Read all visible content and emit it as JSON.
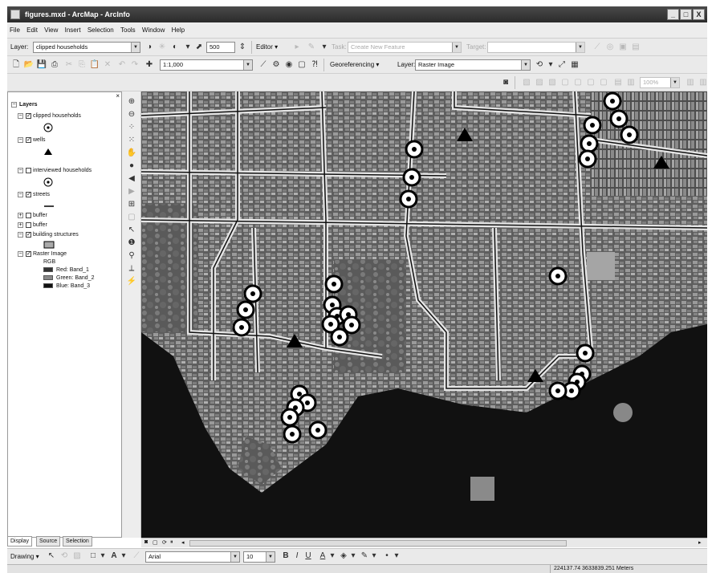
{
  "window": {
    "title": "figures.mxd - ArcMap - ArcInfo",
    "buttons": [
      "_",
      "□",
      "X"
    ]
  },
  "menu": [
    "File",
    "Edit",
    "View",
    "Insert",
    "Selection",
    "Tools",
    "Window",
    "Help"
  ],
  "toolbar1": {
    "layer_label": "Layer:",
    "layer_value": "clipped households",
    "scale_value": "500",
    "editor_label": "Editor ▾",
    "task_label": "Task:",
    "task_value": "Create New Feature",
    "target_label": "Target:",
    "target_value": ""
  },
  "toolbar2": {
    "scale_value": "1:1,000",
    "georef_label": "Georeferencing ▾",
    "layer_label": "Layer:",
    "layer_value": "Raster Image"
  },
  "toolbar3": {
    "zoom_value": "100%"
  },
  "toc": {
    "root": "Layers",
    "layers": [
      {
        "name": "clipped households",
        "checked": true,
        "expanded": true
      },
      {
        "name": "wells",
        "checked": true,
        "expanded": true
      },
      {
        "name": "interviewed households",
        "checked": false,
        "expanded": true
      },
      {
        "name": "streets",
        "checked": true,
        "expanded": true
      },
      {
        "name": "buffer",
        "checked": false,
        "expanded": false
      },
      {
        "name": "buffer",
        "checked": false,
        "expanded": false
      },
      {
        "name": "building structures",
        "checked": true,
        "expanded": true
      },
      {
        "name": "Raster Image",
        "checked": true,
        "expanded": true
      }
    ],
    "rgb_label": "RGB",
    "bands": [
      {
        "label": "Red:   Band_1",
        "color": "#333333"
      },
      {
        "label": "Green: Band_2",
        "color": "#888888"
      },
      {
        "label": "Blue:  Band_3",
        "color": "#111111"
      }
    ],
    "tabs": [
      "Display",
      "Source",
      "Selection"
    ]
  },
  "drawbar": {
    "drawing_label": "Drawing ▾",
    "font_value": "Arial",
    "size_value": "10",
    "bold": "B",
    "italic": "I",
    "underline": "U"
  },
  "status": {
    "coords": "224137.74  3633839.251 Meters"
  },
  "map": {
    "household_count": 34,
    "well_count": 4
  }
}
